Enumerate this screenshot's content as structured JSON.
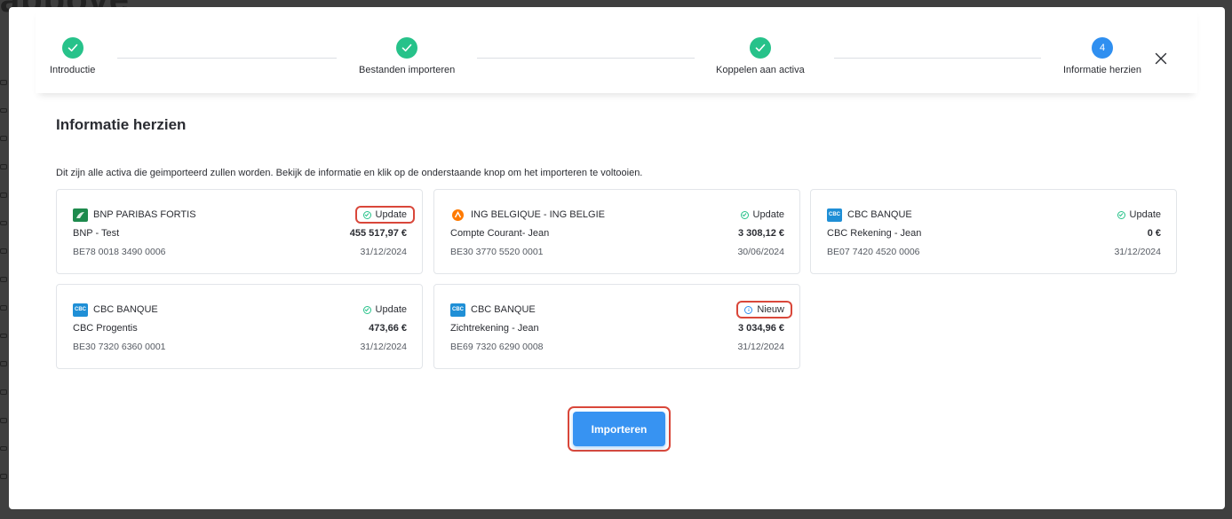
{
  "backdrop": {
    "logo_text": "abbove"
  },
  "stepper": {
    "steps": [
      {
        "label": "Introductie",
        "state": "done"
      },
      {
        "label": "Bestanden importeren",
        "state": "done"
      },
      {
        "label": "Koppelen aan activa",
        "state": "done"
      },
      {
        "label": "Informatie herzien",
        "state": "active",
        "number": "4"
      }
    ]
  },
  "main": {
    "title": "Informatie herzien",
    "description": "Dit zijn alle activa die geimporteerd zullen worden. Bekijk de informatie en klik op de onderstaande knop om het importeren te voltooien.",
    "cards": [
      {
        "bank": "BNP PARIBAS FORTIS",
        "logo": "bnp-logo",
        "status": "Update",
        "account": "BNP - Test",
        "amount": "455 517,97 €",
        "iban": "BE78 0018 3490 0006",
        "date": "31/12/2024"
      },
      {
        "bank": "ING BELGIQUE - ING BELGIE",
        "logo": "ing-logo",
        "status": "Update",
        "account": "Compte Courant- Jean",
        "amount": "3 308,12 €",
        "iban": "BE30 3770 5520 0001",
        "date": "30/06/2024"
      },
      {
        "bank": "CBC BANQUE",
        "logo": "cbc-logo",
        "status": "Update",
        "account": "CBC Rekening - Jean",
        "amount": "0 €",
        "iban": "BE07 7420 4520 0006",
        "date": "31/12/2024"
      },
      {
        "bank": "CBC BANQUE",
        "logo": "cbc-logo",
        "status": "Update",
        "account": "CBC Progentis",
        "amount": "473,66 €",
        "iban": "BE30 7320 6360 0001",
        "date": "31/12/2024"
      },
      {
        "bank": "CBC BANQUE",
        "logo": "cbc-logo",
        "status": "Nieuw",
        "account": "Zichtrekening - Jean",
        "amount": "3 034,96 €",
        "iban": "BE69 7320 6290 0008",
        "date": "31/12/2024"
      }
    ],
    "logo_texts": {
      "cbc": "CBC"
    },
    "import_button": "Importeren"
  },
  "colors": {
    "success": "#27c28a",
    "primary": "#3793f2",
    "highlight": "#d9473a"
  }
}
